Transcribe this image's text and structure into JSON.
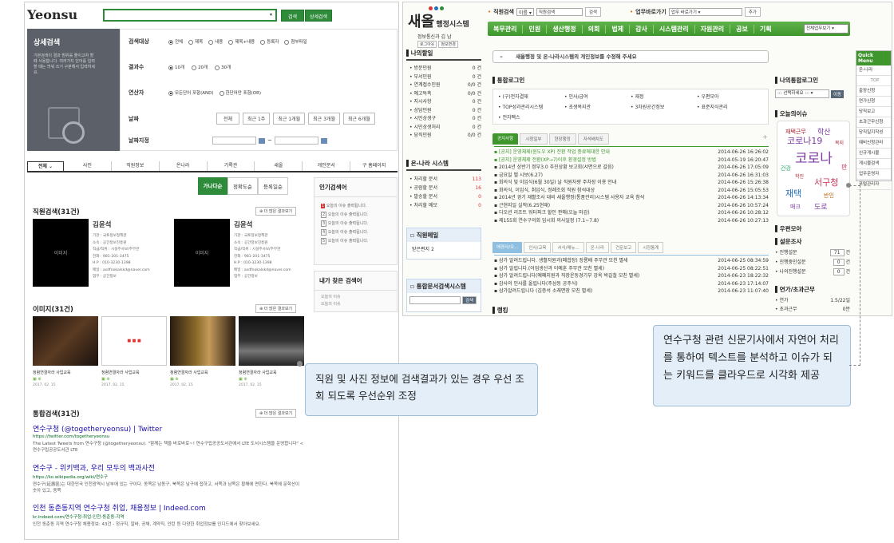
{
  "left": {
    "logo": "Yeonsu",
    "search_button": "검색",
    "detail_search_button": "상세검색",
    "side_title": "상세검색",
    "side_desc": "기본검색이 결과 범위를 줄이고자 할 때 사용합니다. 여러가지 단어를 입력할 때는 띄워 쓰기 구분해서 입력하세요.",
    "form": [
      {
        "label": "검색대상",
        "options": [
          "전체",
          "제목",
          "내용",
          "제목+내용",
          "등록자",
          "첨부파일"
        ]
      },
      {
        "label": "결과수",
        "options": [
          "10개",
          "20개",
          "30개"
        ]
      },
      {
        "label": "연산자",
        "options": [
          "모든단어 포함(AND)",
          "한단어만 포함(OR)"
        ]
      },
      {
        "label": "날짜",
        "buttons": [
          "전체",
          "최근 1주",
          "최근 1개월",
          "최근 3개월",
          "최근 6개월"
        ]
      },
      {
        "label": "날짜지정",
        "sep": "~"
      }
    ],
    "tabs": [
      "전체",
      "사진",
      "직원정보",
      "온나라",
      "기록관",
      "새올",
      "개인문서",
      "구 홈페이지"
    ],
    "sort_buttons": [
      "가나다순",
      "정확도순",
      "등록일순"
    ],
    "staff_title": "직원검색(31건)",
    "staff": [
      {
        "name": "김윤석",
        "photo": "이미지",
        "details": [
          "기관 : 국토정보정책관",
          "소속 : 공간정보진흥원",
          "직급/직위 : 시설주사보/주무관",
          "전화 : 981-201-3475",
          "H.P : 010-3230-1398",
          "메일 : asdfnokalskd@naver.com",
          "업무 : 공간정보"
        ]
      },
      {
        "name": "김윤석",
        "photo": "이미지",
        "details": [
          "기관 : 국토정보정책관",
          "소속 : 공간정보진흥원",
          "직급/직위 : 시설주사보/주무관",
          "전화 : 981-201-3475",
          "H.P : 010-3230-1398",
          "메일 : asdfnokalskd@naver.com",
          "업무 : 공간정보"
        ]
      }
    ],
    "more_label": "더 많은 결과보기",
    "popular_title": "인기검색어",
    "popular": [
      "오늘의 이슈 출력됩니다.",
      "오늘의 이슈 출력됩니다.",
      "오늘의 이슈 출력됩니다.",
      "오늘의 이슈 출력됩니다.",
      "오늘의 이슈 출력됩니다."
    ],
    "recent_title": "내가 찾은 검색어",
    "recent": [
      "오늘의 이슈",
      "오늘의 이슈"
    ],
    "image_title": "이미지(31건)",
    "images": [
      {
        "caption": "청렴연결자라 사업교육",
        "date": "2017. 02. 15"
      },
      {
        "caption": "청렴연결자라 사업교육",
        "date": "2017. 02. 15"
      },
      {
        "caption": "청렴연결자라 사업교육",
        "date": "2017. 02. 15"
      },
      {
        "caption": "청렴연결자라 사업교육",
        "date": "2017. 02. 15"
      }
    ],
    "integrated_title": "통합검색(31건)",
    "results": [
      {
        "title": "연수구청 (@togetheryeonsu) | Twitter",
        "url": "https://twitter.com/togetheryeonsu",
        "desc": "The Latest Tweets from 연수구청 (@togetheryeonsu). \"함께는 책을 바로바로~! 연수구립공공도서관에서 LTE 도서시스템을 운영합니다\" <연수구립공공도서관 LTE"
      },
      {
        "title": "연수구 - 위키백과, 우리 모두의 백과사전",
        "url": "https://ko.wikipedia.org/wiki/연수구",
        "desc": "연수구(延壽區)는 대한민국 인천광역시 남부에 있는 구이다. 동쪽은 남동구, 북쪽은 남구에 접하고, 서쪽과 남쪽은 황해에 면한다. 북쪽에 문학산이 솟아 있고, 동쪽"
      },
      {
        "title": "인천 동춘동지역 연수구청 취업, 채용정보 | Indeed.com",
        "url": "kr.indeed.com/연수구청-취업-인천-동춘동-지역",
        "desc": "인천 동춘동 지역 연수구청 채용정보: 43건 - 정규직, 알바, 공채, 계약직, 인턴 등 다양한 취업정보를 인디드에서 찾아보세요."
      }
    ]
  },
  "right": {
    "logo_main": "새올",
    "logo_sub": "행정시스템",
    "user_dept": "정보통신과",
    "user_name": "김 남",
    "logout": "로그아웃",
    "info_change": "정보변경",
    "staff_search_label": "직원검색",
    "staff_search_select": "이름",
    "staff_search_placeholder": "직원검색",
    "search_btn": "검색",
    "quick_label": "업무바로가기",
    "quick_select": "업무 바로가기",
    "add_btn": "추가",
    "menu": [
      "복무관리",
      "민원",
      "생산행정",
      "의회",
      "법제",
      "감사",
      "시스템관리",
      "자원관리",
      "공보",
      "기획"
    ],
    "menu_select": "전체업무보기",
    "notice_bar": "새올행정 및 온-나라시스템의 개인정보를 수정해 주세요",
    "my_work_title": "나의할일",
    "my_work": [
      [
        "방문민원",
        "0 건"
      ],
      [
        "부서민원",
        "0 건"
      ],
      [
        "연계접수민원",
        "0/0 건"
      ],
      [
        "예고독촉",
        "0/0 건"
      ],
      [
        "지시사항",
        "0 건"
      ],
      [
        "상담민원",
        "0 건"
      ],
      [
        "시민상생구",
        "0 건"
      ],
      [
        "시민상생처리",
        "0 건"
      ],
      [
        "당직민원",
        "0/0 건"
      ]
    ],
    "onnara_title": "온-나라 시스템",
    "onnara": [
      [
        "처리할 문서",
        "113"
      ],
      [
        "공람할 문서",
        "16"
      ],
      [
        "발송할 문서",
        "0"
      ],
      [
        "처리할 메모",
        "0"
      ]
    ],
    "mail_title": "직원메일",
    "mail_item": "받은편지  2",
    "doc_title": "통합문서검색시스템",
    "doc_btn": "검색",
    "login_title": "통합로그인",
    "login_links": [
      "(구)전자결재",
      "인사/급여",
      "재정",
      "우편모아",
      "TOP성과관리시스템",
      "초생복지관",
      "3차원공간정보",
      "표준지식관리",
      "전자팩스"
    ],
    "board_tabs": [
      "공지사항",
      "시청일부",
      "현장행정",
      "자석배치도"
    ],
    "board": [
      [
        "[공지] 운영체제(윈도우 XP) 전환 작업 종료에대한 안내",
        "2014-06-26 16:26:02"
      ],
      [
        "[공지] 운영체제 전환(XP→7)이후 환경설정 방법",
        "2014-05-19 16:20:47"
      ],
      [
        "2014년 상반기 정부3.0 추진상황 보고회(서면으로 갈음)",
        "2014-06-26 17:05:09"
      ],
      [
        "금요일 벨 시보(6.27)",
        "2014-06-26 16:31:03"
      ],
      [
        "회의식 및 이임식(6월 30일) 날 직원차량 주차장 이용 안내",
        "2014-06-26 15:26:38"
      ],
      [
        "회의식, 이임식, 취임식, 정례조회 직원 참석대상",
        "2014-06-26 15:05:53"
      ],
      [
        "2014년 경기 재활조사 대비 새올행정(통품관리)시스템 사용자 교육 참석",
        "2014-06-26 14:13:34"
      ],
      [
        "근현지일 실적(6.25현재)",
        "2014-06-26 10:57:24"
      ],
      [
        "디오션 리조트 워터파크 할인 판매(오늘 마감)",
        "2014-06-26 10:28:12"
      ],
      [
        "제155회 연수구의회 임시회 의사일정 (7.1~7.8)",
        "2014-06-26 10:27:13"
      ]
    ],
    "board2_tabs": [
      "애경사/오...",
      "인사/교육",
      "서식/매뉴...",
      "온-나라",
      "건문보고",
      "시정통계"
    ],
    "board2": [
      [
        "삼가 알려드립니다. 생활자원과(폐합장) 장룡배 주무관 모친 별세",
        "2014-06-25 08:34:59"
      ],
      [
        "삼가 알립니다.(어업생산과 이예훈 주무관 모친 별세)",
        "2014-06-25 08:22:51"
      ],
      [
        "삼가 알려드립니다(예폐지원과 직장운동경기부 강옥 박길철 모친 별세)",
        "2014-06-23 18:22:32"
      ],
      [
        "감사의 인사를 올립니다(주삼동 공주식)",
        "2014-06-23 17:14:07"
      ],
      [
        "삼가알려드립니다 (김증석 소래면장 모친 별세)",
        "2014-06-23 11:07:40"
      ]
    ],
    "ranking_title": "랭킹",
    "my_login_title": "나의통합로그인",
    "my_login_select": "선택하세요",
    "my_login_btn": "이동",
    "issue_title": "오늘의이슈",
    "cloud_words": [
      "재택근무",
      "학산",
      "코로나19",
      "복지",
      "코로나",
      "건강",
      "학진",
      "서구청",
      "판",
      "재택",
      "반인",
      "매크",
      "도로"
    ],
    "mail_box_title": "우편모아",
    "survey_title": "설문조사",
    "survey": [
      [
        "진행설문",
        "71",
        "건"
      ],
      [
        "진행중인설문",
        "0",
        "건"
      ],
      [
        "나의진행설문",
        "0",
        "건"
      ]
    ],
    "annual_title": "연가/초과근무",
    "annual": [
      [
        "연가",
        "1.5/22일"
      ],
      [
        "초과근무",
        "0분"
      ]
    ],
    "quick_menu_title": "Quick Menu",
    "quick_menu": [
      "온-나라",
      "TOP",
      "출장신청",
      "연가신청",
      "당직보고",
      "초과근무신청",
      "당직일지작성",
      "예비신청관리",
      "신규게시물",
      "게시물검색",
      "업무운영자",
      "포털관리자"
    ]
  },
  "callouts": {
    "left": "직원 및 사진 정보에 검색결과가 있는 경우 우선 조회 되도록 우선순위 조정",
    "right": "연수구청 관련 신문기사에서 자연어 처리를 통하여 텍스트를 분석하고 이슈가 되는 키워드를 클라우드로 시각화  제공"
  }
}
